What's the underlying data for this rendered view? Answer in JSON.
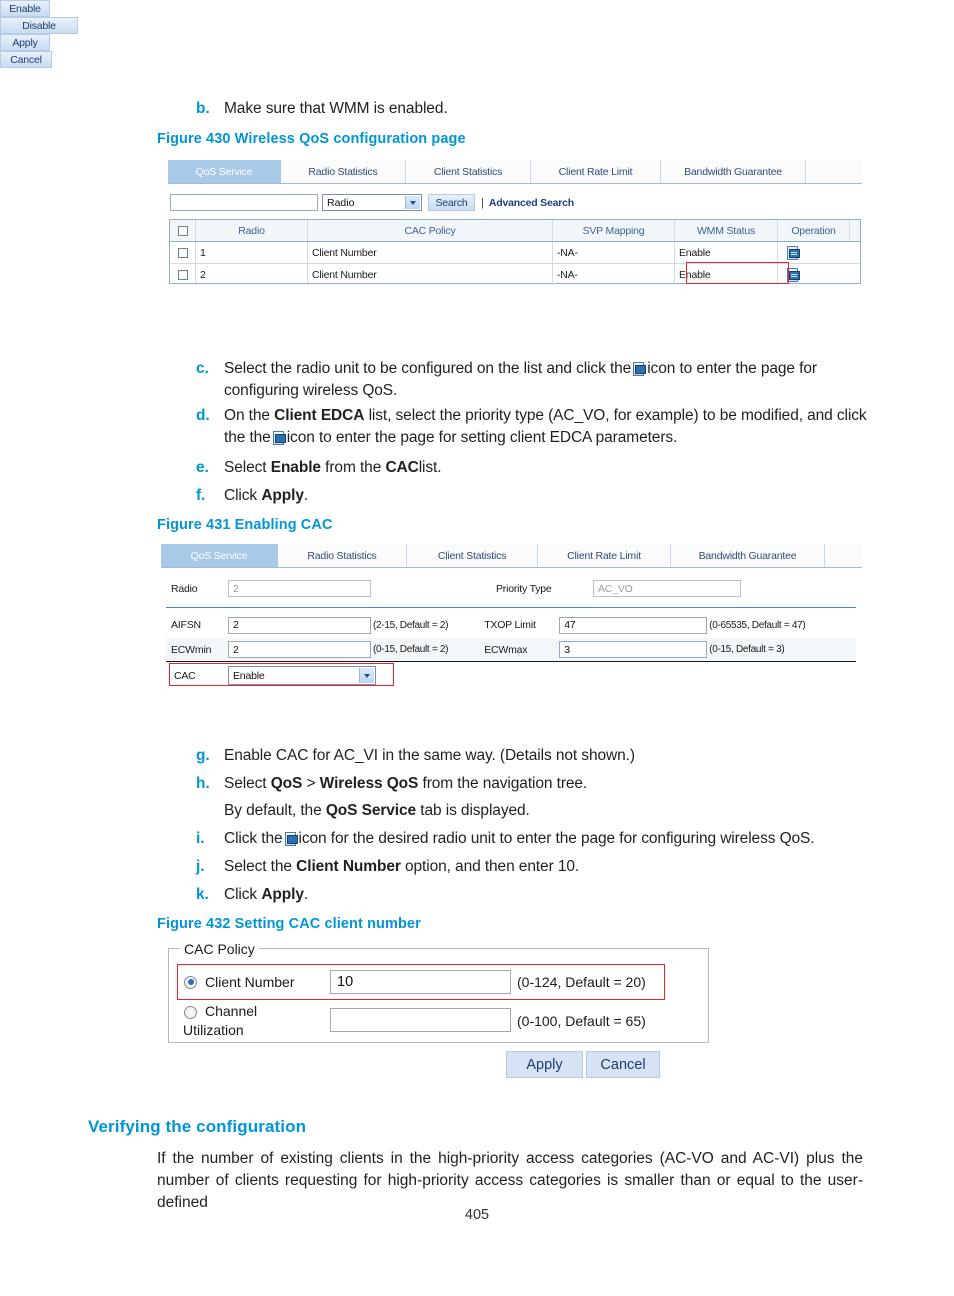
{
  "page": {
    "number": "405"
  },
  "steps": {
    "b": {
      "mark": "b.",
      "text": "Make sure that WMM is enabled."
    },
    "c": {
      "mark": "c.",
      "pre": "Select the radio unit to be configured on the list and click the",
      "post": "icon to enter the page for configuring wireless QoS."
    },
    "d": {
      "mark": "d.",
      "pre": "On the",
      "bold1": "Client EDCA",
      "mid": "list, select the priority type (AC_VO, for example) to be modified, and click the",
      "post": "icon to enter the page for setting client EDCA parameters."
    },
    "e": {
      "mark": "e.",
      "pre": "Select",
      "bold1": "Enable",
      "mid": "from the",
      "bold2": "CAC",
      "post": "list."
    },
    "f": {
      "mark": "f.",
      "pre": "Click",
      "bold1": "Apply",
      "post": "."
    },
    "g": {
      "mark": "g.",
      "text": "Enable CAC for AC_VI in the same way. (Details not shown.)"
    },
    "h": {
      "mark": "h.",
      "pre": "Select",
      "bold1": "QoS",
      "mid": ">",
      "bold2": "Wireless QoS",
      "post": "from the navigation tree.",
      "sub_pre": "By default, the",
      "sub_bold": "QoS Service",
      "sub_post": "tab is displayed."
    },
    "i": {
      "mark": "i.",
      "pre": "Click the",
      "post": "icon for the desired radio unit to enter the page for configuring wireless QoS."
    },
    "j": {
      "mark": "j.",
      "pre": "Select the",
      "bold1": "Client Number",
      "post": "option, and then enter 10."
    },
    "k": {
      "mark": "k.",
      "pre": "Click",
      "bold1": "Apply",
      "post": "."
    }
  },
  "figure430": {
    "caption": "Figure 430 Wireless QoS configuration page",
    "tabs": [
      {
        "label": "QoS Service",
        "active": true
      },
      {
        "label": "Radio Statistics",
        "active": false
      },
      {
        "label": "Client Statistics",
        "active": false
      },
      {
        "label": "Client Rate Limit",
        "active": false
      },
      {
        "label": "Bandwidth Guarantee",
        "active": false
      }
    ],
    "search": {
      "input_value": "",
      "select_value": "Radio",
      "search_button": "Search",
      "advanced_link": "Advanced Search",
      "separator": "|"
    },
    "table": {
      "headers": [
        "",
        "Radio",
        "CAC Policy",
        "SVP Mapping",
        "WMM Status",
        "Operation"
      ],
      "rows": [
        {
          "radio": "1",
          "cac_policy": "Client Number",
          "svp_mapping": "-NA-",
          "wmm_status": "Enable",
          "operation_icon": "edit-page-icon"
        },
        {
          "radio": "2",
          "cac_policy": "Client Number",
          "svp_mapping": "-NA-",
          "wmm_status": "Enable",
          "operation_icon": "edit-page-icon"
        }
      ]
    },
    "buttons": {
      "enable": "Enable",
      "disable": "Disable"
    }
  },
  "figure431": {
    "caption": "Figure 431 Enabling CAC",
    "tabs": [
      {
        "label": "QoS Service",
        "active": true
      },
      {
        "label": "Radio Statistics",
        "active": false
      },
      {
        "label": "Client Statistics",
        "active": false
      },
      {
        "label": "Client Rate Limit",
        "active": false
      },
      {
        "label": "Bandwidth Guarantee",
        "active": false
      }
    ],
    "fields": {
      "radio_label": "Radio",
      "radio_value": "2",
      "priority_type_label": "Priority Type",
      "priority_type_value": "AC_VO",
      "aifsn_label": "AIFSN",
      "aifsn_value": "2",
      "aifsn_hint": "(2-15, Default = 2)",
      "txop_label": "TXOP Limit",
      "txop_value": "47",
      "txop_hint": "(0-65535, Default = 47)",
      "ecwmin_label": "ECWmin",
      "ecwmin_value": "2",
      "ecwmin_hint": "(0-15, Default = 2)",
      "ecwmax_label": "ECWmax",
      "ecwmax_value": "3",
      "ecwmax_hint": "(0-15, Default = 3)",
      "cac_label": "CAC",
      "cac_value": "Enable"
    },
    "buttons": {
      "apply": "Apply",
      "cancel": "Cancel"
    }
  },
  "figure432": {
    "caption": "Figure 432 Setting CAC client number",
    "legend": "CAC Policy",
    "client_number": {
      "label": "Client Number",
      "value": "10",
      "hint": "(0-124, Default = 20)",
      "selected": true
    },
    "channel_utilization": {
      "label_line1": "Channel",
      "label_line2": "Utilization",
      "value": "",
      "hint": "(0-100, Default = 65)",
      "selected": false
    },
    "buttons": {
      "apply": "Apply",
      "cancel": "Cancel"
    }
  },
  "verifying": {
    "heading": "Verifying the configuration",
    "paragraph": "If the number of existing clients in the high-priority access categories (AC-VO and AC-VI) plus the number of clients requesting for high-priority access categories is smaller than or equal to the user-defined"
  }
}
